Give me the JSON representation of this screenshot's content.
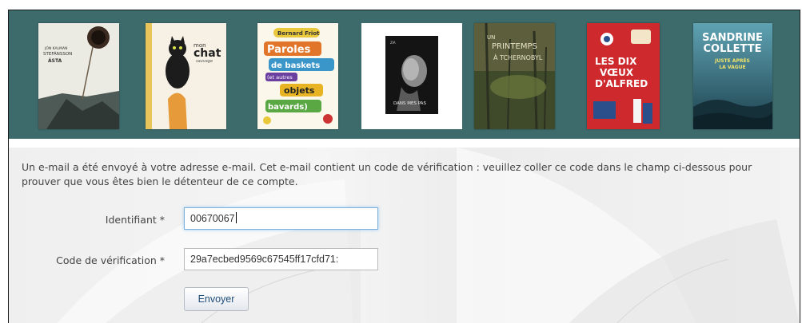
{
  "banner": {
    "background": "#3d6b6b",
    "covers": [
      {
        "name": "cover-asta",
        "author_line1": "JÓN KALMAN",
        "author_line2": "STEFÁNSSON",
        "title": "ÁSTA"
      },
      {
        "name": "cover-mon-chat-sauvage",
        "title_small": "mon",
        "title": "chat",
        "subtitle": "sauvage"
      },
      {
        "name": "cover-paroles-de-baskets",
        "author": "Bernard Friot",
        "words": [
          "Paroles",
          "de baskets",
          "(et autres",
          "objets",
          "bavards)"
        ]
      },
      {
        "name": "cover-dans-mes-pas",
        "author": "ZIA",
        "title": "DANS MES PAS"
      },
      {
        "name": "cover-un-printemps-a-tchernobyl",
        "line1": "UN",
        "line2": "PRINTEMPS",
        "line3": "À TCHERNOBYL"
      },
      {
        "name": "cover-les-dix-voeux-dalfred",
        "line1": "LES DIX",
        "line2": "VŒUX",
        "line3": "D'ALFRED"
      },
      {
        "name": "cover-juste-apres-la-vague",
        "author_line1": "SANDRINE",
        "author_line2": "COLLETTE",
        "title_line1": "JUSTE APRÈS",
        "title_line2": "LA VAGUE"
      }
    ]
  },
  "form": {
    "message": "Un e-mail a été envoyé à votre adresse e-mail. Cet e-mail contient un code de vérification : veuillez coller ce code dans le champ ci-dessous pour prouver que vous êtes bien le détenteur de ce compte.",
    "identifiant_label": "Identifiant *",
    "identifiant_value": "00670067",
    "code_label": "Code de vérification *",
    "code_value": "29a7ecbed9569c67545ff17cfd71:",
    "submit_label": "Envoyer"
  }
}
